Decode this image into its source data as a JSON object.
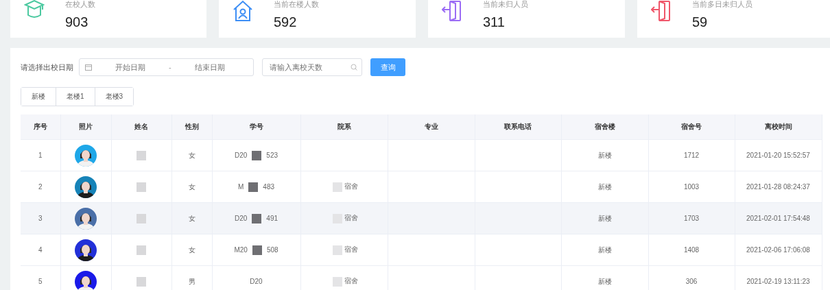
{
  "stats": [
    {
      "label": "在校人数",
      "value": "903",
      "kind": "cap",
      "color": "#4cc9a0"
    },
    {
      "label": "当前在楼人数",
      "value": "592",
      "kind": "house",
      "color": "#3d8ef5"
    },
    {
      "label": "当前未归人员",
      "value": "311",
      "kind": "door",
      "color": "#9b6cf5"
    },
    {
      "label": "当前多日未归人员",
      "value": "59",
      "kind": "door",
      "color": "#f0566a"
    }
  ],
  "filter": {
    "label": "请选择出校日期",
    "start_placeholder": "开始日期",
    "separator": "-",
    "end_placeholder": "结束日期",
    "days_placeholder": "请输入离校天数",
    "query_button": "查询"
  },
  "building_tabs": [
    "新楼",
    "老楼1",
    "老楼3"
  ],
  "table": {
    "columns": [
      "序号",
      "照片",
      "姓名",
      "性别",
      "学号",
      "院系",
      "专业",
      "联系电话",
      "宿舍楼",
      "宿舍号",
      "离校时间"
    ],
    "rows": [
      {
        "index": "1",
        "gender": "女",
        "id_parts": [
          "D20",
          "523"
        ],
        "dept": "",
        "building": "新楼",
        "room": "1712",
        "time": "2021-01-20 15:52:57",
        "highlighted": false
      },
      {
        "index": "2",
        "gender": "女",
        "id_parts": [
          "M",
          "483"
        ],
        "dept": "宿舍",
        "building": "新楼",
        "room": "1003",
        "time": "2021-01-28 08:24:37",
        "highlighted": false
      },
      {
        "index": "3",
        "gender": "女",
        "id_parts": [
          "D20",
          "491"
        ],
        "dept": "宿舍",
        "building": "新楼",
        "room": "1703",
        "time": "2021-02-01 17:54:48",
        "highlighted": true
      },
      {
        "index": "4",
        "gender": "女",
        "id_parts": [
          "M20",
          "508"
        ],
        "dept": "宿舍",
        "building": "新楼",
        "room": "1408",
        "time": "2021-02-06 17:06:08",
        "highlighted": false
      },
      {
        "index": "5",
        "gender": "男",
        "id_parts": [
          "D20"
        ],
        "dept": "宿舍",
        "building": "新楼",
        "room": "306",
        "time": "2021-02-19 13:11:23",
        "highlighted": false
      }
    ]
  }
}
